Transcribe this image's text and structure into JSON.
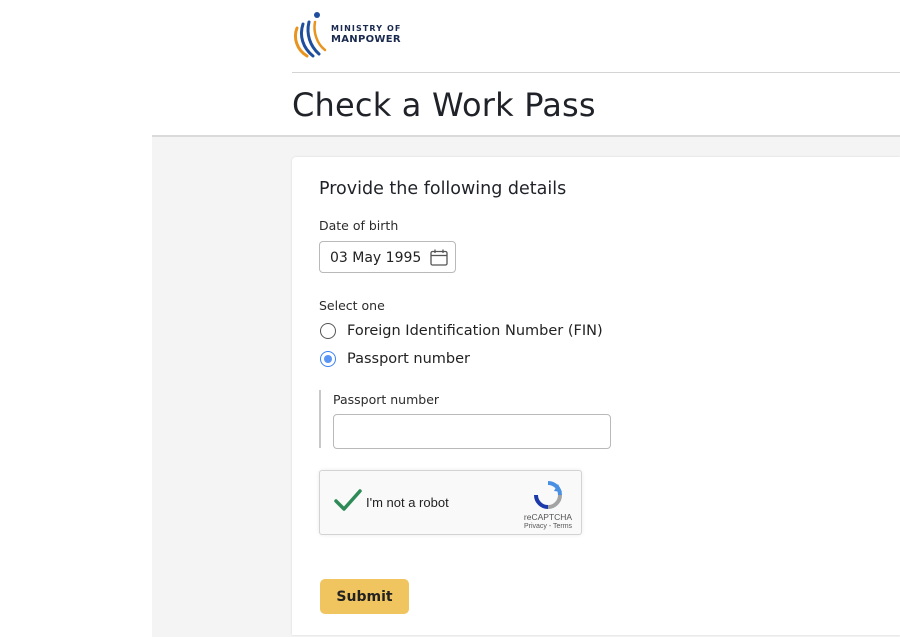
{
  "header": {
    "logo_line1": "MINISTRY OF",
    "logo_line2": "MANPOWER",
    "page_title": "Check a Work Pass"
  },
  "form": {
    "heading": "Provide the following details",
    "dob_label": "Date of birth",
    "dob_value": "03 May 1995",
    "select_label": "Select one",
    "options": [
      {
        "label": "Foreign Identification Number (FIN)",
        "selected": false
      },
      {
        "label": "Passport number",
        "selected": true
      }
    ],
    "passport_label": "Passport number",
    "passport_value": "",
    "submit_label": "Submit"
  },
  "recaptcha": {
    "checked": true,
    "label": "I'm not a robot",
    "brand": "reCAPTCHA",
    "links": "Privacy - Terms"
  },
  "icons": {
    "logo": "mom-logo-icon",
    "date": "calendar-icon",
    "recaptcha_check": "checkmark-icon",
    "recaptcha_logo": "recaptcha-logo-icon"
  },
  "colors": {
    "submit_bg": "#f0c55f",
    "radio_selected": "#5a95f5",
    "checkmark": "#2e8b57",
    "page_background": "#f4f4f4"
  }
}
